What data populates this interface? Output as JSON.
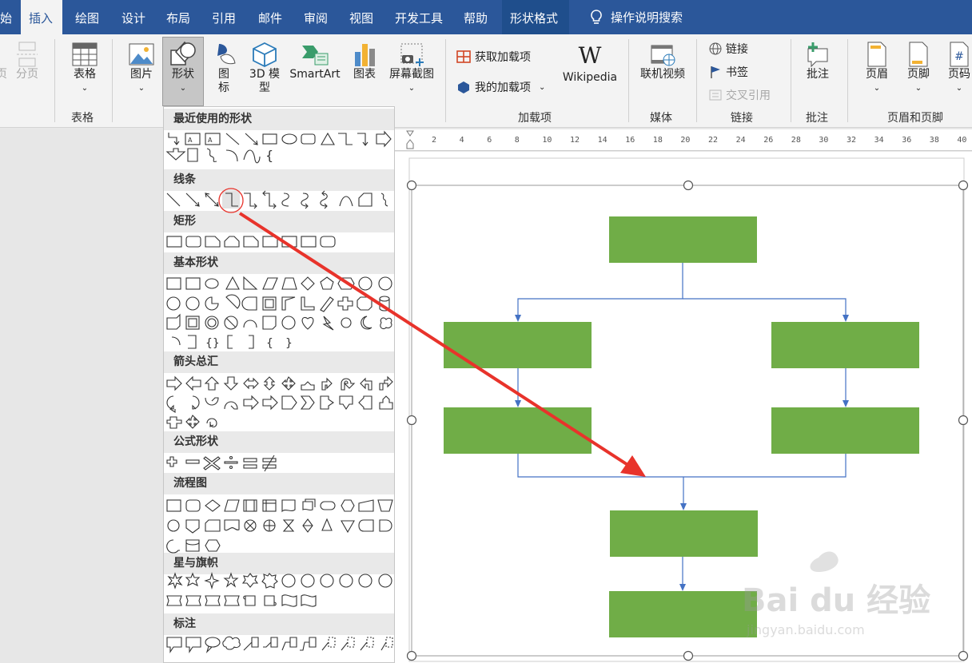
{
  "tabs": [
    {
      "label": "始",
      "left": 0
    },
    {
      "label": "插入",
      "active": true
    },
    {
      "label": "绘图"
    },
    {
      "label": "设计"
    },
    {
      "label": "布局"
    },
    {
      "label": "引用"
    },
    {
      "label": "邮件"
    },
    {
      "label": "审阅"
    },
    {
      "label": "视图"
    },
    {
      "label": "开发工具"
    },
    {
      "label": "帮助"
    },
    {
      "label": "形状格式",
      "context": true
    }
  ],
  "search_label": "操作说明搜索",
  "ribbon": {
    "page_break": "分页",
    "page_left": "页",
    "table": "表格",
    "table_group": "表格",
    "picture": "图片",
    "shapes": "形状",
    "icons": "图\n标",
    "model3d": "3D 模\n型",
    "smartart": "SmartArt",
    "chart": "图表",
    "screenshot": "屏幕截图",
    "get_addins": "获取加载项",
    "my_addins": "我的加载项",
    "wikipedia": "Wikipedia",
    "addins_group": "加载项",
    "online_video": "联机视频",
    "media_group": "媒体",
    "link": "链接",
    "bookmark": "书签",
    "cross_ref": "交叉引用",
    "links_group": "链接",
    "comment": "批注",
    "comment_group": "批注",
    "header": "页眉",
    "footer": "页脚",
    "page_number": "页码",
    "header_footer_group": "页眉和页脚"
  },
  "gallery": {
    "sections": [
      "最近使用的形状",
      "线条",
      "矩形",
      "基本形状",
      "箭头总汇",
      "公式形状",
      "流程图",
      "星与旗帜",
      "标注"
    ]
  },
  "ruler_ticks": [
    "2",
    "4",
    "6",
    "8",
    "10",
    "12",
    "14",
    "16",
    "18",
    "20",
    "22",
    "24",
    "26",
    "28",
    "30",
    "32",
    "34",
    "36",
    "38",
    "40"
  ],
  "colors": {
    "tabbar": "#2b579a",
    "box_fill": "#70ad47",
    "connector": "#4472c4",
    "annotation": "#e8332b"
  },
  "watermark": {
    "brand": "Bai du 经验",
    "url": "jingyan.baidu.com"
  }
}
